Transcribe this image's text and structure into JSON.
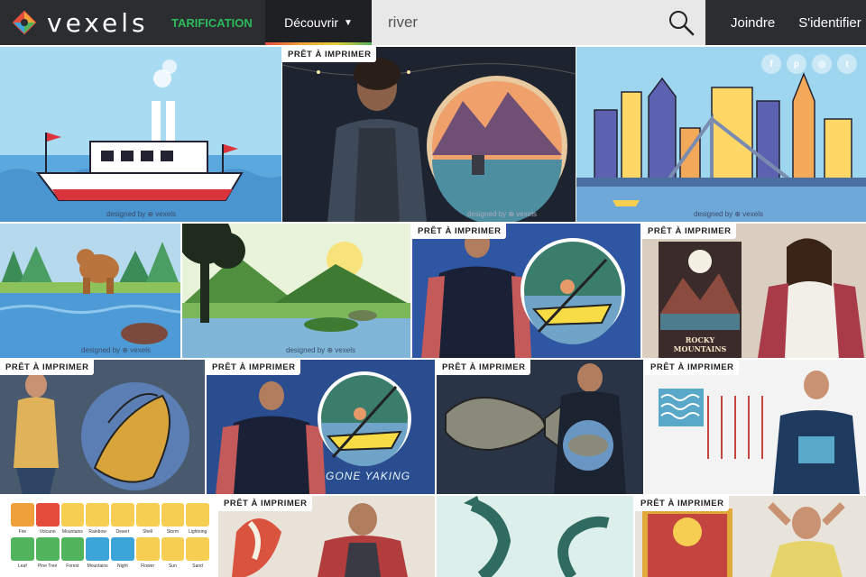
{
  "header": {
    "logo_text": "vexels",
    "pricing_label": "TARIFICATION",
    "discover_label": "Découvrir",
    "search_value": "river",
    "join_label": "Joindre",
    "login_label": "S'identifier"
  },
  "grid": {
    "badge_label": "PRÊT À IMPRIMER",
    "watermark": "designed by ⊕ vexels",
    "poster_text": "ROCKY MOUNTAINS",
    "tshirt_text": "GONE YAKING",
    "social_icons": [
      "f",
      "p",
      "◎",
      "t"
    ],
    "icon_sheet_labels": [
      "Fire",
      "Volcano",
      "Mountains",
      "Rainbow",
      "Desert",
      "Shell",
      "Storm",
      "Lightning",
      "Leaf",
      "Pine Tree",
      "Forest",
      "Mountains",
      "Night",
      "Flower",
      "Sun",
      "Sand"
    ]
  },
  "colors": {
    "topbar": "#2b2d31",
    "pricing": "#2bbb5a",
    "search_bg": "#e8e8e8"
  }
}
